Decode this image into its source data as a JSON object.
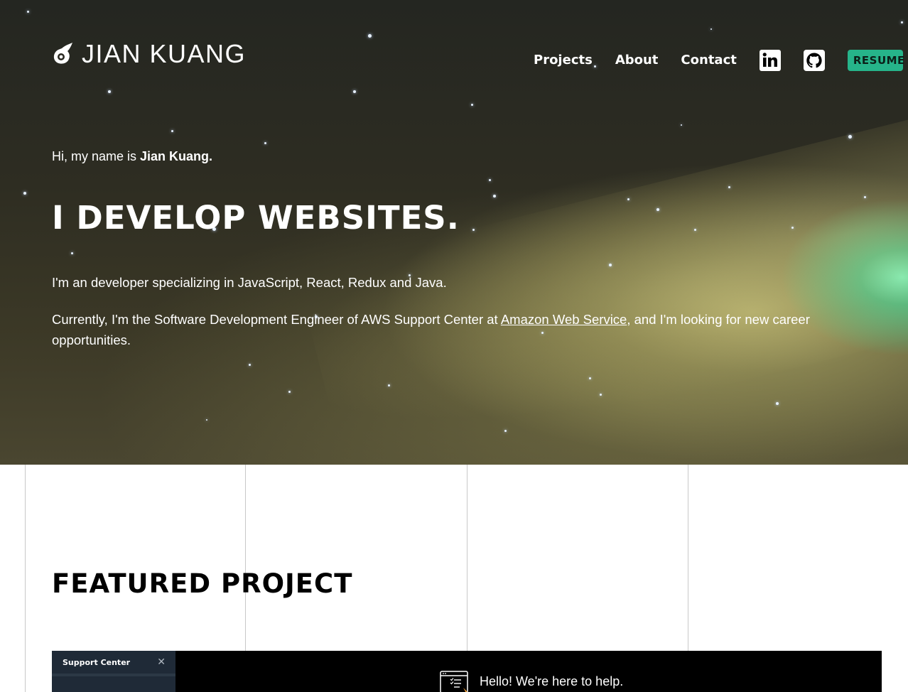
{
  "header": {
    "logo_text": "JIAN KUANG",
    "nav": {
      "projects": "Projects",
      "about": "About",
      "contact": "Contact",
      "resume": "RESUME"
    },
    "social": [
      "linkedin-icon",
      "github-icon"
    ]
  },
  "hero": {
    "intro_prefix": "Hi, my name is ",
    "intro_name": "Jian Kuang.",
    "headline": "I DEVELOP WEBSITES.",
    "desc1": "I'm an developer specializing in JavaScript, React, Redux and Java.",
    "desc2_prefix": "Currently, I'm the Software Development Engineer of AWS Support Center at ",
    "desc2_link": "Amazon Web Service",
    "desc2_suffix": ", and I'm looking for new career opportunities."
  },
  "featured": {
    "title": "FEATURED PROJECT",
    "preview": {
      "sidebar_title": "Support Center",
      "close_glyph": "✕",
      "hello_text": "Hello! We're here to help."
    }
  },
  "colors": {
    "accent": "#26b48a",
    "hero_dark": "#242621",
    "comet_green": "#78ffc8",
    "preview_bg": "#000000",
    "preview_sidebar": "#1f2a37"
  }
}
